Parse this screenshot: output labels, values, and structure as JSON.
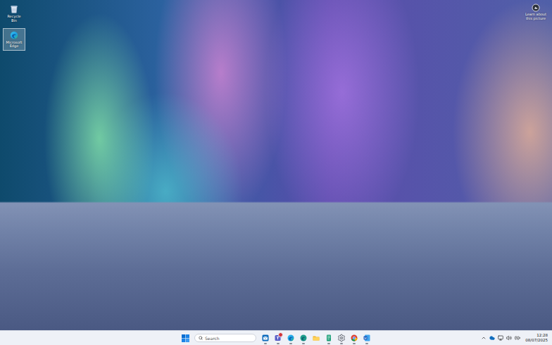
{
  "desktop": {
    "icons": [
      {
        "kind": "recycle-bin",
        "label": "Recycle Bin",
        "selected": false
      },
      {
        "kind": "edge",
        "label": "Microsoft Edge",
        "selected": true
      }
    ],
    "spotlight": {
      "label": "Learn about this picture"
    }
  },
  "taskbar": {
    "start": {
      "selected": false
    },
    "search": {
      "placeholder": "Search"
    },
    "apps": [
      {
        "kind": "outlook",
        "running": true,
        "badge": false
      },
      {
        "kind": "teams",
        "running": true,
        "badge": true
      },
      {
        "kind": "edge",
        "running": true,
        "badge": false
      },
      {
        "kind": "edge-beta",
        "running": true,
        "badge": false
      },
      {
        "kind": "file-explorer",
        "running": false,
        "badge": false
      },
      {
        "kind": "notepad",
        "running": true,
        "badge": false
      },
      {
        "kind": "settings",
        "running": true,
        "badge": false
      },
      {
        "kind": "chrome",
        "running": true,
        "badge": false
      },
      {
        "kind": "word",
        "running": true,
        "badge": false
      }
    ],
    "tray": {
      "icons": [
        {
          "kind": "chevron"
        },
        {
          "kind": "onedrive"
        },
        {
          "kind": "display"
        },
        {
          "kind": "volume"
        },
        {
          "kind": "battery"
        }
      ],
      "time": "12:28",
      "date": "08/07/2025"
    }
  }
}
